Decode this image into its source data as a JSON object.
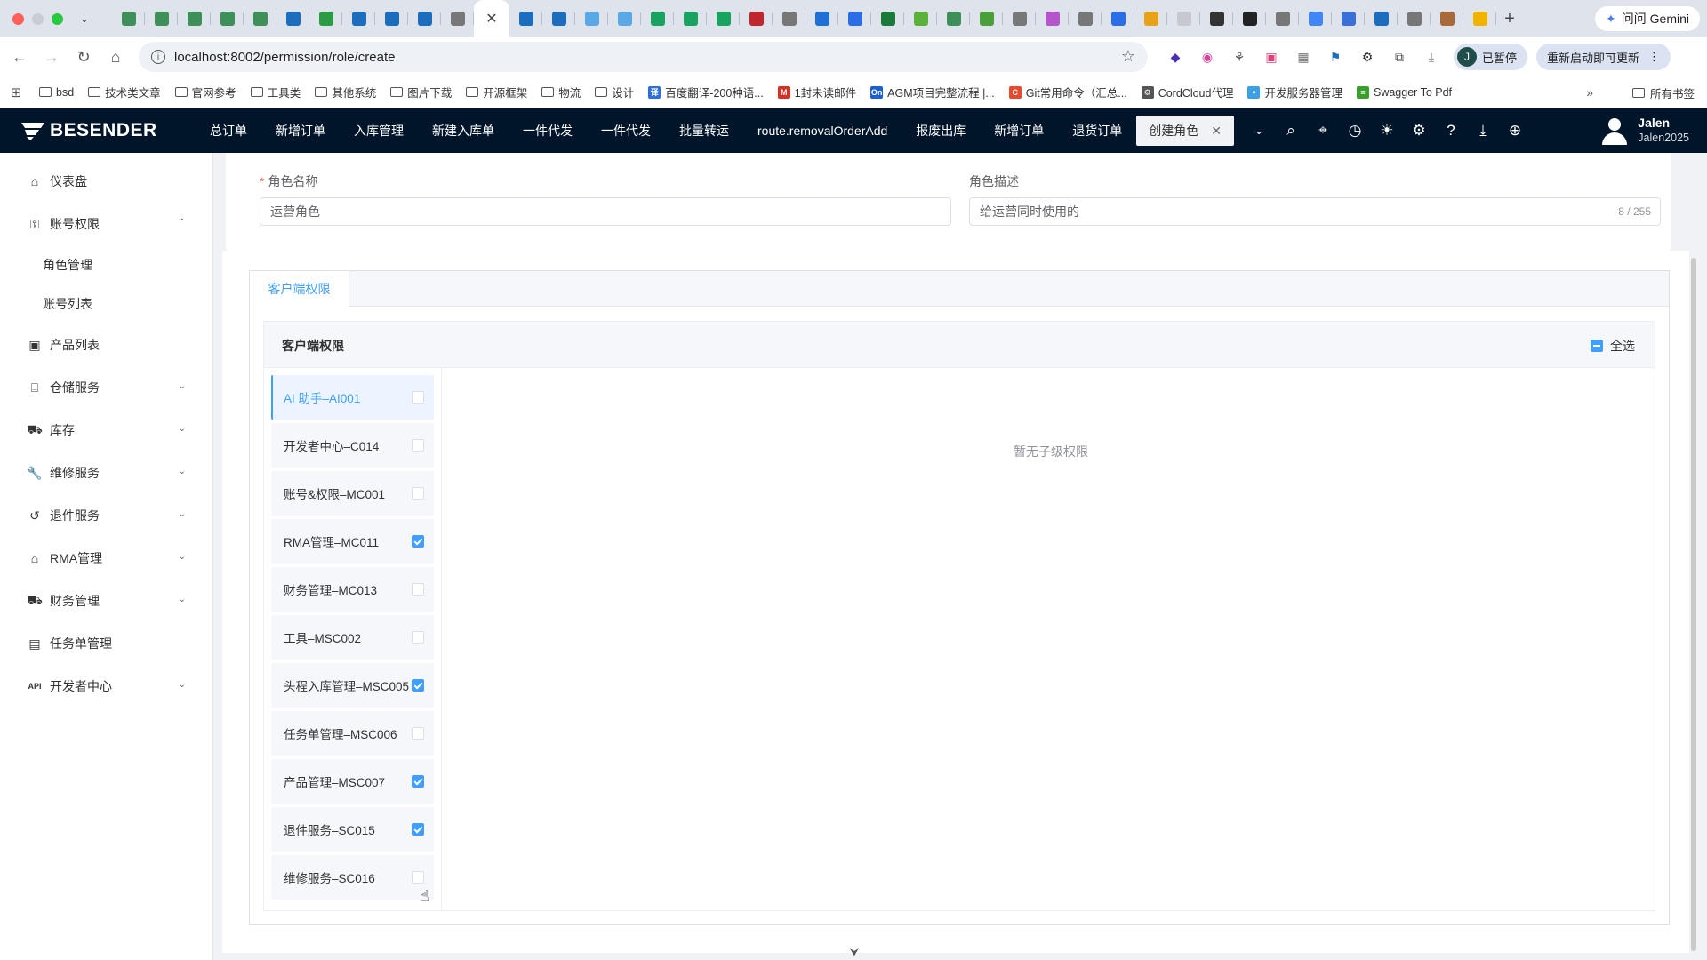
{
  "browser": {
    "url": "localhost:8002/permission/role/create",
    "gemini_label": "问问 Gemini",
    "profile_initial": "J",
    "paused_label": "已暂停",
    "restart_label": "重新启动即可更新",
    "bookmarks": [
      {
        "label": "bsd",
        "type": "folder"
      },
      {
        "label": "技术类文章",
        "type": "folder"
      },
      {
        "label": "官网参考",
        "type": "folder"
      },
      {
        "label": "工具类",
        "type": "folder"
      },
      {
        "label": "其他系统",
        "type": "folder"
      },
      {
        "label": "图片下载",
        "type": "folder"
      },
      {
        "label": "开源框架",
        "type": "folder"
      },
      {
        "label": "物流",
        "type": "folder"
      },
      {
        "label": "设计",
        "type": "folder"
      },
      {
        "label": "百度翻译-200种语...",
        "type": "site",
        "color": "#2b6de5",
        "glyph": "译"
      },
      {
        "label": "1封未读邮件",
        "type": "site",
        "color": "#d93025",
        "glyph": "M"
      },
      {
        "label": "AGM项目完整流程 |...",
        "type": "site",
        "color": "#1a5fd8",
        "glyph": "On"
      },
      {
        "label": "Git常用命令（汇总...",
        "type": "site",
        "color": "#e8492f",
        "glyph": "C"
      },
      {
        "label": "CordCloud代理",
        "type": "site",
        "color": "#555555",
        "glyph": "⚙"
      },
      {
        "label": "开发服务器管理",
        "type": "site",
        "color": "#3aa0e8",
        "glyph": "✦"
      },
      {
        "label": "Swagger To Pdf",
        "type": "site",
        "color": "#3a9f2e",
        "glyph": "≡"
      }
    ],
    "all_bookmarks_label": "所有书签"
  },
  "header": {
    "logo_text": "BESENDER",
    "nav_tabs": [
      "总订单",
      "新增订单",
      "入库管理",
      "新建入库单",
      "一件代发",
      "一件代发",
      "批量转运",
      "route.removalOrderAdd",
      "报废出库",
      "新增订单",
      "退货订单"
    ],
    "active_tab": "创建角色",
    "user_name": "Jalen",
    "user_id": "Jalen2025"
  },
  "sidebar": {
    "items": [
      {
        "label": "仪表盘",
        "icon": "home-icon",
        "glyph": "⌂",
        "arrow": ""
      },
      {
        "label": "账号权限",
        "icon": "key-icon",
        "glyph": "⚿",
        "arrow": "⌃"
      },
      {
        "label": "产品列表",
        "icon": "product-icon",
        "glyph": "▣",
        "arrow": ""
      },
      {
        "label": "仓储服务",
        "icon": "warehouse-icon",
        "glyph": "⌸",
        "arrow": "⌄"
      },
      {
        "label": "库存",
        "icon": "inventory-icon",
        "glyph": "⛟",
        "arrow": "⌄"
      },
      {
        "label": "维修服务",
        "icon": "wrench-icon",
        "glyph": "🔧",
        "arrow": "⌄"
      },
      {
        "label": "退件服务",
        "icon": "return-icon",
        "glyph": "↺",
        "arrow": "⌄"
      },
      {
        "label": "RMA管理",
        "icon": "rma-icon",
        "glyph": "⌂",
        "arrow": "⌄"
      },
      {
        "label": "财务管理",
        "icon": "finance-icon",
        "glyph": "⛟",
        "arrow": "⌄"
      },
      {
        "label": "任务单管理",
        "icon": "task-icon",
        "glyph": "▤",
        "arrow": ""
      },
      {
        "label": "开发者中心",
        "icon": "api-icon",
        "glyph": "API",
        "arrow": "⌄"
      }
    ],
    "sub_items": [
      "角色管理",
      "账号列表"
    ]
  },
  "form": {
    "name_label": "角色名称",
    "name_value": "运营角色",
    "desc_label": "角色描述",
    "desc_value": "给运营同时使用的",
    "desc_count": "8 / 255"
  },
  "permissions": {
    "tab_label": "客户端权限",
    "title": "客户端权限",
    "select_all_label": "全选",
    "empty_text": "暂无子级权限",
    "items": [
      {
        "label": "AI 助手–AI001",
        "checked": false,
        "active": true
      },
      {
        "label": "开发者中心–C014",
        "checked": false,
        "active": false
      },
      {
        "label": "账号&权限–MC001",
        "checked": false,
        "active": false
      },
      {
        "label": "RMA管理–MC011",
        "checked": true,
        "active": false
      },
      {
        "label": "财务管理–MC013",
        "checked": false,
        "active": false
      },
      {
        "label": "工具–MSC002",
        "checked": false,
        "active": false
      },
      {
        "label": "头程入库管理–MSC005",
        "checked": true,
        "active": false
      },
      {
        "label": "任务单管理–MSC006",
        "checked": false,
        "active": false
      },
      {
        "label": "产品管理–MSC007",
        "checked": true,
        "active": false
      },
      {
        "label": "退件服务–SC015",
        "checked": true,
        "active": false
      },
      {
        "label": "维修服务–SC016",
        "checked": false,
        "active": false
      }
    ]
  }
}
